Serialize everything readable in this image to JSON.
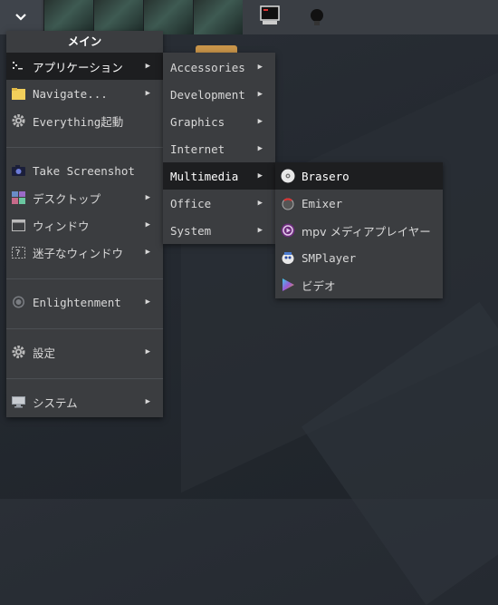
{
  "menu_main": {
    "title": "メイン",
    "items": [
      {
        "label": "アプリケーション",
        "icon": "terminal-dots-icon"
      },
      {
        "label": "Navigate...",
        "icon": "folder-icon"
      },
      {
        "label": "Everything起動",
        "icon": "gear-icon"
      },
      {
        "label": "Take Screenshot",
        "icon": "camera-icon"
      },
      {
        "label": "デスクトップ",
        "icon": "desktop-grid-icon"
      },
      {
        "label": "ウィンドウ",
        "icon": "window-icon"
      },
      {
        "label": "迷子なウィンドウ",
        "icon": "lost-window-icon"
      },
      {
        "label": "Enlightenment",
        "icon": "enlightenment-icon"
      },
      {
        "label": "設定",
        "icon": "settings-gear-icon"
      },
      {
        "label": "システム",
        "icon": "computer-icon"
      }
    ]
  },
  "menu_applications": {
    "items": [
      "Accessories",
      "Development",
      "Graphics",
      "Internet",
      "Multimedia",
      "Office",
      "System"
    ]
  },
  "menu_multimedia": {
    "items": [
      "Brasero",
      "Emixer",
      "mpv メディアプレイヤー",
      "SMPlayer",
      "ビデオ"
    ]
  },
  "colors": {
    "menu_bg": "#3b3d40",
    "selected_bg": "#1d1e20",
    "shelf_bg": "#3a3e44"
  }
}
